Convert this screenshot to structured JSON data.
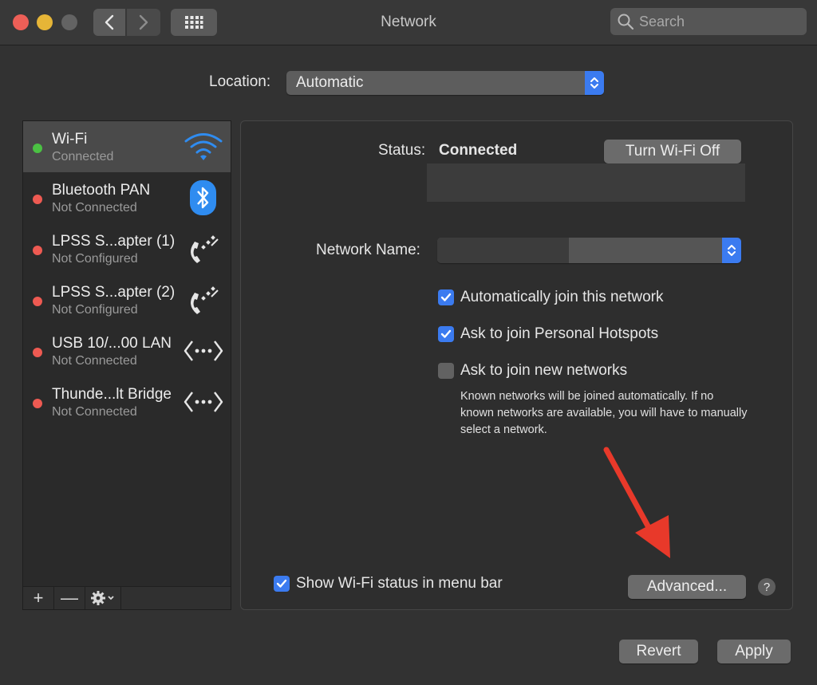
{
  "window": {
    "title": "Network",
    "search_placeholder": "Search"
  },
  "location": {
    "label": "Location:",
    "value": "Automatic"
  },
  "services": [
    {
      "name": "Wi-Fi",
      "status": "Connected",
      "icon": "wifi-icon",
      "dot": "#4bc143",
      "selected": true
    },
    {
      "name": "Bluetooth PAN",
      "status": "Not Connected",
      "icon": "bluetooth-icon",
      "dot": "#ee5a52"
    },
    {
      "name": "LPSS S...apter (1)",
      "status": "Not Configured",
      "icon": "phone-icon",
      "dot": "#ee5a52"
    },
    {
      "name": "LPSS S...apter (2)",
      "status": "Not Configured",
      "icon": "phone-icon",
      "dot": "#ee5a52"
    },
    {
      "name": "USB 10/...00 LAN",
      "status": "Not Connected",
      "icon": "ethernet-icon",
      "dot": "#ee5a52"
    },
    {
      "name": "Thunde...lt Bridge",
      "status": "Not Connected",
      "icon": "ethernet-icon",
      "dot": "#ee5a52"
    }
  ],
  "sidebar_controls": {
    "add": "+",
    "remove": "—"
  },
  "detail": {
    "status_label": "Status:",
    "status_value": "Connected",
    "wifi_toggle_label": "Turn Wi-Fi Off",
    "network_name_label": "Network Name:",
    "options": [
      {
        "label": "Automatically join this network",
        "checked": true
      },
      {
        "label": "Ask to join Personal Hotspots",
        "checked": true
      },
      {
        "label": "Ask to join new networks",
        "checked": false
      }
    ],
    "note": "Known networks will be joined automatically. If no known networks are available, you will have to manually select a network.",
    "show_status_label": "Show Wi-Fi status in menu bar",
    "show_status_checked": true,
    "advanced_label": "Advanced...",
    "help_label": "?"
  },
  "footer": {
    "revert_label": "Revert",
    "apply_label": "Apply"
  },
  "colors": {
    "accent": "#3b7bf0",
    "annotation_arrow": "#e8392a"
  }
}
